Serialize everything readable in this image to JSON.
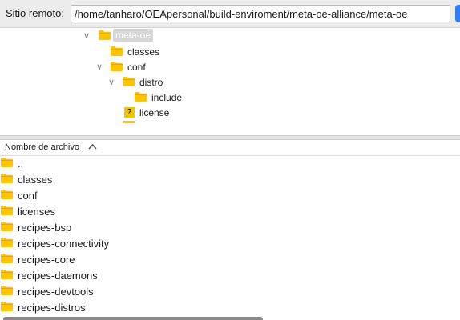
{
  "path_bar": {
    "label": "Sitio remoto:",
    "value": "/home/tanharo/OEApersonal/build-enviroment/meta-oe-alliance/meta-oe"
  },
  "tree": {
    "items": [
      {
        "label": "meta-oe",
        "twisty": "∨",
        "icon": "folder",
        "selected": true
      },
      {
        "label": "classes",
        "twisty": "",
        "icon": "folder",
        "selected": false
      },
      {
        "label": "conf",
        "twisty": "∨",
        "icon": "folder",
        "selected": false
      },
      {
        "label": "distro",
        "twisty": "∨",
        "icon": "folder",
        "selected": false
      },
      {
        "label": "include",
        "twisty": "",
        "icon": "folder",
        "selected": false
      },
      {
        "label": "license",
        "twisty": "",
        "icon": "unknown",
        "selected": false
      }
    ]
  },
  "file_list": {
    "column_name": "Nombre de archivo",
    "sort_direction": "ascending",
    "rows": [
      {
        "name": ".."
      },
      {
        "name": "classes"
      },
      {
        "name": "conf"
      },
      {
        "name": "licenses"
      },
      {
        "name": "recipes-bsp"
      },
      {
        "name": "recipes-connectivity"
      },
      {
        "name": "recipes-core"
      },
      {
        "name": "recipes-daemons"
      },
      {
        "name": "recipes-devtools"
      },
      {
        "name": "recipes-distros"
      }
    ]
  },
  "colors": {
    "folder": "#ffc400",
    "folder_dark": "#e6a800",
    "accent": "#2f7ef6"
  }
}
